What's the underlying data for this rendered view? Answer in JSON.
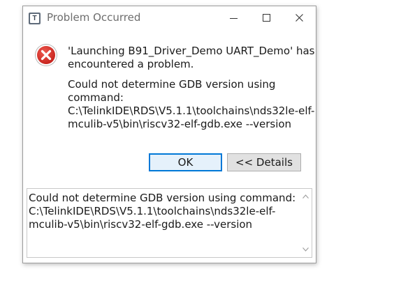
{
  "window": {
    "title": "Problem Occurred",
    "app_icon_letter": "T"
  },
  "icons": {
    "app": "telink-ide-icon",
    "error": "error-icon",
    "minimize": "minimize-icon",
    "maximize": "maximize-icon",
    "close": "close-icon",
    "scroll_up": "chevron-up-icon",
    "scroll_down": "chevron-down-icon"
  },
  "message": {
    "header_lines": [
      "'Launching B91_Driver_Demo UART_Demo' has",
      "encountered a problem."
    ],
    "body_lines": [
      "Could not determine GDB version using",
      "command:",
      "C:\\TelinkIDE\\RDS\\V5.1.1\\toolchains\\nds32le-elf-",
      "mculib-v5\\bin\\riscv32-elf-gdb.exe --version"
    ]
  },
  "buttons": {
    "ok_label": "OK",
    "details_label": "<< Details"
  },
  "details": {
    "lines": [
      "Could not determine GDB version using command:",
      "C:\\TelinkIDE\\RDS\\V5.1.1\\toolchains\\nds32le-elf-",
      "mculib-v5\\bin\\riscv32-elf-gdb.exe --version"
    ]
  },
  "colors": {
    "error_red": "#d9302a",
    "focus_blue": "#0078d7",
    "button_gray": "#e1e1e1",
    "title_gray": "#6d6d6d"
  }
}
